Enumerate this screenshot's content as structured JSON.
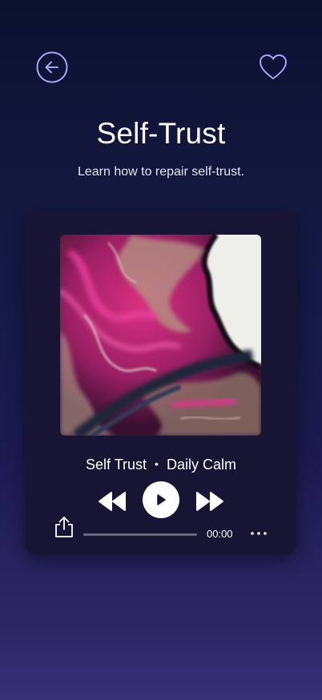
{
  "header": {
    "back_icon": "arrow-left-circle-icon",
    "favorite_icon": "heart-outline-icon",
    "accent_color": "#a9a4f5"
  },
  "page": {
    "title": "Self-Trust",
    "subtitle": "Learn how to repair self-trust."
  },
  "player": {
    "track_name": "Self Trust",
    "separator": "•",
    "album_name": "Daily Calm",
    "time_elapsed": "00:00",
    "progress": 0,
    "controls": {
      "rewind_icon": "rewind-icon",
      "play_icon": "play-icon",
      "fast_forward_icon": "fast-forward-icon",
      "share_icon": "share-icon",
      "more_icon": "more-horizontal-icon"
    },
    "card_color": "#181434"
  }
}
